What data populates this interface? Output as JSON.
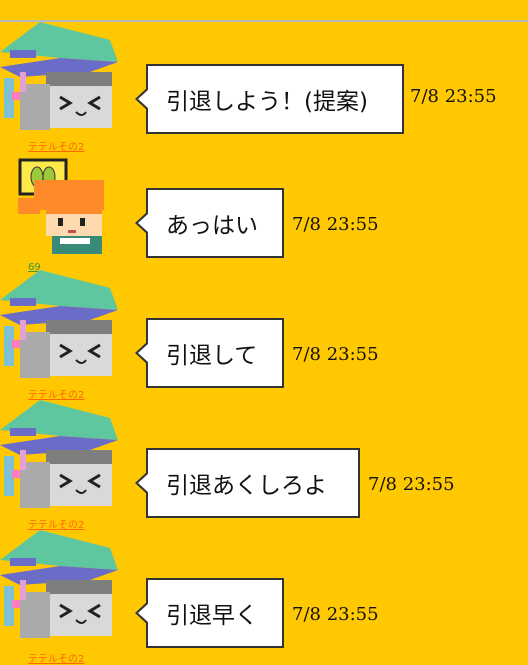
{
  "messages": [
    {
      "user": "テテルその2",
      "text": "引退しよう！(提案)",
      "time": "7/8 23:55"
    },
    {
      "user": "69",
      "text": "あっはい",
      "time": "7/8 23:55"
    },
    {
      "user": "テテルその2",
      "text": "引退して",
      "time": "7/8 23:55"
    },
    {
      "user": "テテルその2",
      "text": "引退あくしろよ",
      "time": "7/8 23:55"
    },
    {
      "user": "テテルその2",
      "text": "引退早く",
      "time": "7/8 23:55"
    }
  ]
}
